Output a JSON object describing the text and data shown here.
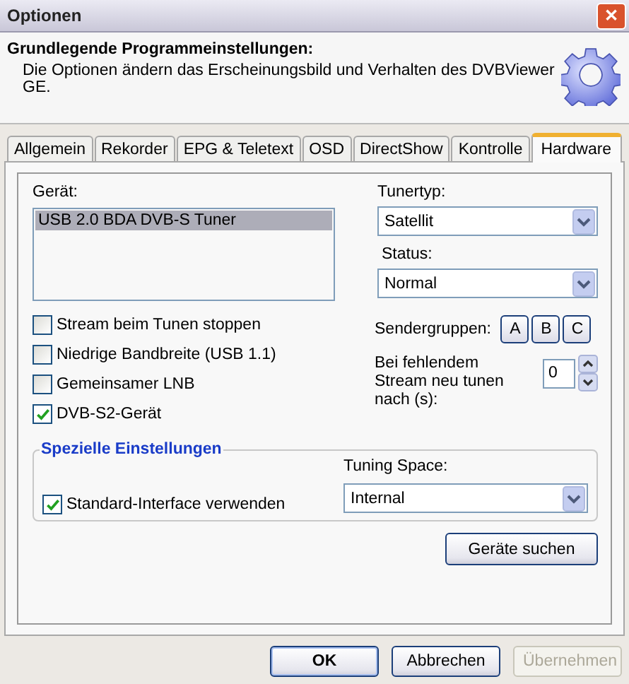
{
  "window": {
    "title": "Optionen",
    "close": "✕"
  },
  "header": {
    "title": "Grundlegende Programmeinstellungen:",
    "description": "Die Optionen ändern das Erscheinungsbild und Verhalten des DVBViewer GE."
  },
  "tabs": [
    {
      "label": "Allgemein",
      "selected": false
    },
    {
      "label": "Rekorder",
      "selected": false
    },
    {
      "label": "EPG & Teletext",
      "selected": false
    },
    {
      "label": "OSD",
      "selected": false
    },
    {
      "label": "DirectShow",
      "selected": false
    },
    {
      "label": "Kontrolle",
      "selected": false
    },
    {
      "label": "Hardware",
      "selected": true
    }
  ],
  "device": {
    "label": "Gerät:",
    "items": [
      {
        "text": "USB 2.0 BDA DVB-S Tuner",
        "selected": true
      }
    ]
  },
  "tuner_type": {
    "label": "Tunertyp:",
    "value": "Satellit"
  },
  "status": {
    "label": "Status:",
    "value": "Normal"
  },
  "checkboxes": [
    {
      "label": "Stream beim Tunen stoppen",
      "checked": false
    },
    {
      "label": "Niedrige Bandbreite (USB 1.1)",
      "checked": false
    },
    {
      "label": "Gemeinsamer LNB",
      "checked": false
    },
    {
      "label": "DVB-S2-Gerät",
      "checked": true
    }
  ],
  "channel_groups": {
    "label": "Sendergruppen:",
    "buttons": [
      "A",
      "B",
      "C"
    ]
  },
  "retune": {
    "label": "Bei fehlendem Stream neu tunen nach (s):",
    "value": "0"
  },
  "special": {
    "title": "Spezielle Einstellungen",
    "checkbox": {
      "label": "Standard-Interface verwenden",
      "checked": true
    },
    "tuning_space": {
      "label": "Tuning Space:",
      "value": "Internal"
    }
  },
  "search_button": "Geräte suchen",
  "buttons": [
    {
      "label": "OK",
      "kind": "default",
      "disabled": false
    },
    {
      "label": "Abbrechen",
      "kind": "normal",
      "disabled": false
    },
    {
      "label": "Übernehmen",
      "kind": "normal",
      "disabled": true
    }
  ]
}
